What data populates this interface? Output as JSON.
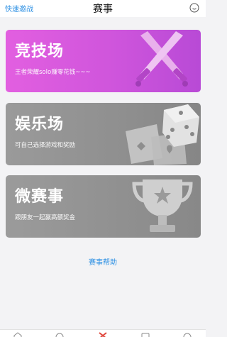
{
  "header": {
    "quick_invite": "快速邀战",
    "title": "赛事",
    "chat_icon": "chat-bubble-icon"
  },
  "cards": [
    {
      "title": "竞技场",
      "subtitle": "王者荣耀solo赚零花钱~~~",
      "art_icon": "crossed-swords-icon",
      "color": "#d657de"
    },
    {
      "title": "娱乐场",
      "subtitle": "可自己选择游戏和奖励",
      "art_icon": "dice-and-cards-icon",
      "color": "#919191"
    },
    {
      "title": "微赛事",
      "subtitle": "跟朋友一起赢高额奖金",
      "art_icon": "trophy-icon",
      "color": "#929292"
    }
  ],
  "help_link": "赛事帮助",
  "tabbar": {
    "icons": [
      "home-tab-icon",
      "chat-tab-icon",
      "match-tab-icon",
      "message-tab-icon",
      "profile-tab-icon"
    ],
    "active_color": "#e0483e"
  },
  "colors": {
    "link": "#2b8fe3",
    "background": "#f3f3f5"
  }
}
